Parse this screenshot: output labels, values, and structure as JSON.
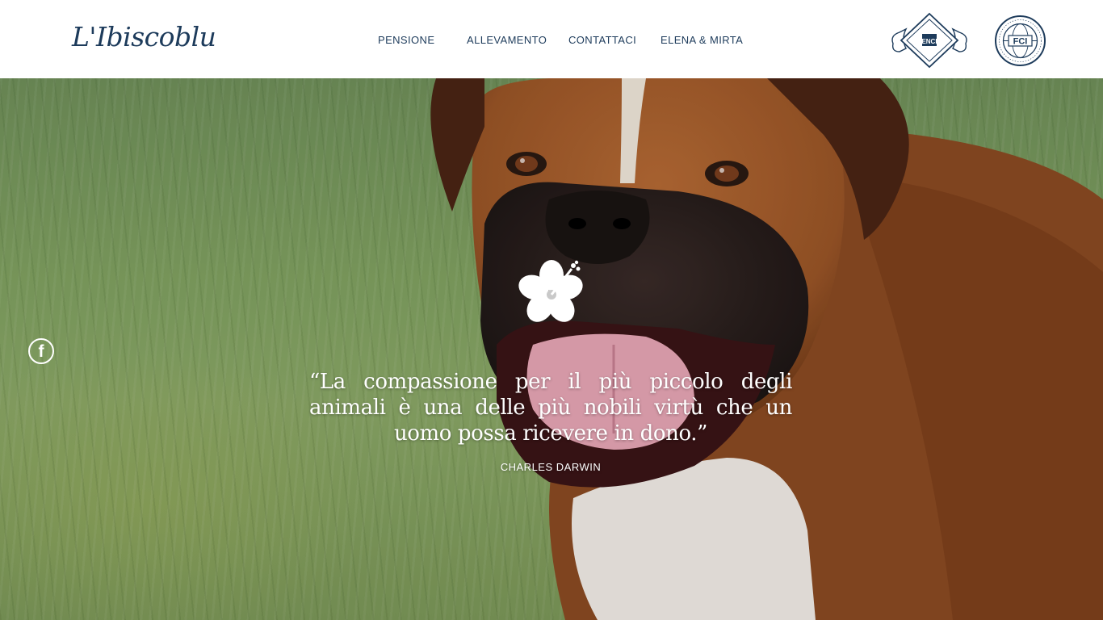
{
  "header": {
    "logo_text": "L'Ibiscoblu",
    "nav": [
      {
        "label": "PENSIONE"
      },
      {
        "label": "ALLEVAMENTO"
      },
      {
        "label": "CONTATTACI"
      },
      {
        "label": "ELENA & MIRTA"
      }
    ],
    "badges": {
      "enci_text": "ENCI",
      "fci_text": "FCI"
    }
  },
  "hero": {
    "quote": "“La compassione per il più piccolo degli animali è una delle più nobili virtù che un uomo possa ricevere in dono.”",
    "author": "CHARLES DARWIN",
    "social_icon": "facebook-icon",
    "flower_icon": "hibiscus-icon"
  },
  "colors": {
    "brand": "#1d3b5b",
    "hero_text": "#ffffff"
  }
}
